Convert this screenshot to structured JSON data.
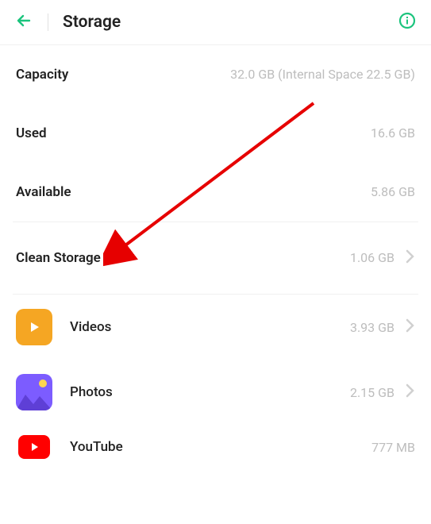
{
  "header": {
    "title": "Storage"
  },
  "capacity": {
    "label": "Capacity",
    "value": "32.0 GB (Internal Space 22.5 GB)"
  },
  "used": {
    "label": "Used",
    "value": "16.6 GB"
  },
  "available": {
    "label": "Available",
    "value": "5.86 GB"
  },
  "clean": {
    "label": "Clean Storage",
    "value": "1.06 GB"
  },
  "apps": [
    {
      "icon": "videos",
      "label": "Videos",
      "value": "3.93 GB"
    },
    {
      "icon": "photos",
      "label": "Photos",
      "value": "2.15 GB"
    },
    {
      "icon": "youtube",
      "label": "YouTube",
      "value": "777 MB"
    }
  ]
}
